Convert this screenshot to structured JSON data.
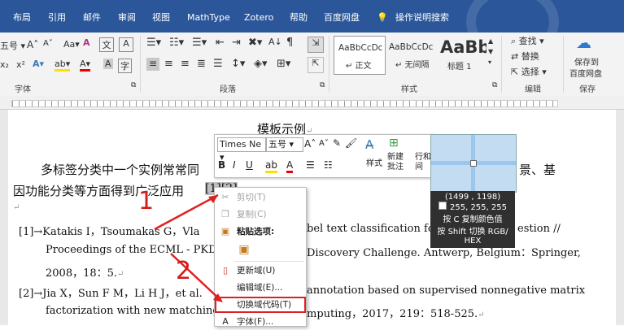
{
  "tabs": [
    "布局",
    "引用",
    "邮件",
    "审阅",
    "视图",
    "MathType",
    "Zotero",
    "帮助",
    "百度网盘",
    "操作说明搜索"
  ],
  "ribbon": {
    "font_group": "字体",
    "paragraph_group": "段落",
    "styles_group": "样式",
    "edit_group": "编辑",
    "save_group": "保存",
    "font_size": "五号",
    "clear_label": "Aa",
    "styles": [
      {
        "preview": "AaBbCcDc",
        "name": "↵ 正文"
      },
      {
        "preview": "AaBbCcDc",
        "name": "↵ 无间隔"
      },
      {
        "preview": "AaBb",
        "name": "标题 1"
      }
    ],
    "find": "查找",
    "replace": "替换",
    "select": "选择",
    "save_baidu_1": "保存到",
    "save_baidu_2": "百度网盘"
  },
  "doc": {
    "title": "模板示例",
    "line1": "多标签分类中一个实例常常同",
    "line1_end": "景、基",
    "line2": "因功能分类等方面得到广泛应用",
    "line2_ref": "[1][2]",
    "ref1_a": "[1]→Katakis I，Tsoumakas G，Vla",
    "ref1_b": "bel text classification for au",
    "ref1_c": "estion //",
    "ref1_d": "Proceedings of the ECML - PKDD/",
    "ref1_e": "Discovery Challenge. Antwerp, Belgium：Springer,",
    "ref1_f": "2008，18：5.",
    "ref2_a": "[2]→Jia X，Sun F M，Li H J，et al.",
    "ref2_b": "annotation based on supervised nonnegative matrix",
    "ref2_c": "factorization with new matching me",
    "ref2_d": "mputing，2017，219：518-525.",
    "annot1": "1",
    "annot2": "2"
  },
  "mini": {
    "font": "Times Ne",
    "size": "五号",
    "style_label": "样式",
    "new_comment_1": "新建",
    "new_comment_2": "批注",
    "row_label": "行和",
    "row_label2": "间"
  },
  "context_menu": [
    {
      "label": "剪切(T)",
      "icon": "cut-icon",
      "glyph": "✂",
      "disabled": true
    },
    {
      "label": "复制(C)",
      "icon": "copy-icon",
      "glyph": "❐",
      "disabled": true
    },
    {
      "label": "粘贴选项:",
      "icon": "paste-icon",
      "glyph": "📋",
      "disabled": false,
      "bold": true
    },
    {
      "label": "",
      "icon": "paste-option-icon",
      "glyph": "📋",
      "disabled": false
    },
    {
      "label": "更新域(U)",
      "icon": "update-field-icon",
      "glyph": "❘",
      "disabled": false
    },
    {
      "label": "编辑域(E)...",
      "icon": "",
      "glyph": "",
      "disabled": false
    },
    {
      "label": "切换域代码(T)",
      "icon": "",
      "glyph": "",
      "disabled": false,
      "highlight": true
    },
    {
      "label": "字体(F)...",
      "icon": "font-icon",
      "glyph": "A",
      "disabled": false
    }
  ],
  "picker": {
    "coords": "(1499 , 1198)",
    "rgb": "255, 255, 255",
    "hint1": "按 C 复制颜色值",
    "hint2": "按 Shift 切换 RGB/",
    "hint3": "HEX"
  },
  "colors": {
    "ribbon_blue": "#2b579a",
    "annot_red": "#e02020"
  }
}
